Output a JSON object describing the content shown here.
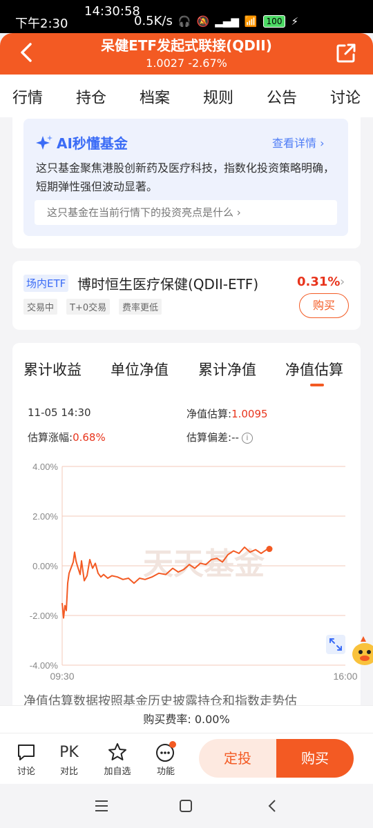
{
  "status": {
    "time_left": "下午2:30",
    "time_top": "14:30:58",
    "speed": "0.5K/s",
    "battery": "100"
  },
  "header": {
    "title": "呆健ETF发起式联接(QDII)",
    "subtitle": "1.0027 -2.67%"
  },
  "tabs": [
    "行情",
    "持仓",
    "档案",
    "规则",
    "公告",
    "讨论"
  ],
  "ai": {
    "title": "AI秒懂基金",
    "more": "查看详情",
    "text": "这只基金聚焦港股创新药及医疗科技，指数化投资策略明确，短期弹性强但波动显著。",
    "question": "这只基金在当前行情下的投资亮点是什么"
  },
  "etf": {
    "tag": "场内ETF",
    "name": "博时恒生医疗保健(QDII-ETF)",
    "pct": "0.31%",
    "chips": [
      "交易中",
      "T+0交易",
      "费率更低"
    ],
    "buy": "购买"
  },
  "chart_tabs": [
    "累计收益",
    "单位净值",
    "累计净值",
    "净值估算"
  ],
  "info": {
    "datetime": "11-05 14:30",
    "nav_est_label": "净值估算:",
    "nav_est_value": "1.0095",
    "chg_label": "估算涨幅:",
    "chg_value": "0.68%",
    "dev_label": "估算偏差:",
    "dev_value": "--"
  },
  "chart_data": {
    "type": "line",
    "ylim": [
      -4,
      4
    ],
    "yticks": [
      "4.00%",
      "2.00%",
      "0.00%",
      "-2.00%",
      "-4.00%"
    ],
    "ytick_values": [
      4,
      2,
      0,
      -2,
      -4
    ],
    "x_start": "09:30",
    "x_end": "16:00",
    "watermark": "天天基金",
    "line_color": "#f35a23",
    "series": [
      {
        "x": [
          0,
          2,
          4,
          6,
          8,
          10,
          14,
          16,
          18,
          20,
          22,
          26,
          28,
          32,
          36,
          40,
          44,
          48,
          52,
          56,
          60,
          66,
          72,
          80,
          88,
          96,
          104,
          112,
          120,
          130,
          140,
          150,
          160,
          168,
          176,
          184,
          192,
          200,
          208,
          216,
          224,
          232,
          240,
          248,
          256,
          264,
          272,
          280,
          288,
          296,
          300
        ],
        "y": [
          -1.5,
          -2.1,
          -1.6,
          -1.8,
          -0.7,
          -0.3,
          0.0,
          0.15,
          0.55,
          0.2,
          0.0,
          -0.35,
          0.2,
          -0.6,
          -0.4,
          0.25,
          -0.1,
          0.1,
          -0.3,
          -0.45,
          -0.35,
          -0.5,
          -0.4,
          -0.45,
          -0.55,
          -0.5,
          -0.7,
          -0.5,
          -0.55,
          -0.45,
          -0.3,
          -0.35,
          -0.1,
          -0.25,
          -0.15,
          0.05,
          -0.1,
          0.1,
          0.05,
          0.25,
          0.3,
          0.15,
          0.45,
          0.6,
          0.5,
          0.75,
          0.55,
          0.65,
          0.5,
          0.65,
          0.68
        ]
      }
    ]
  },
  "chart_note": "净值估算数据按照基金历史披露持仓和指数走势估",
  "fee": "购买费率: 0.00%",
  "bottom": {
    "items": [
      "讨论",
      "对比",
      "加自选",
      "功能"
    ],
    "pk": "PK",
    "dingtou": "定投",
    "buy": "购买"
  }
}
